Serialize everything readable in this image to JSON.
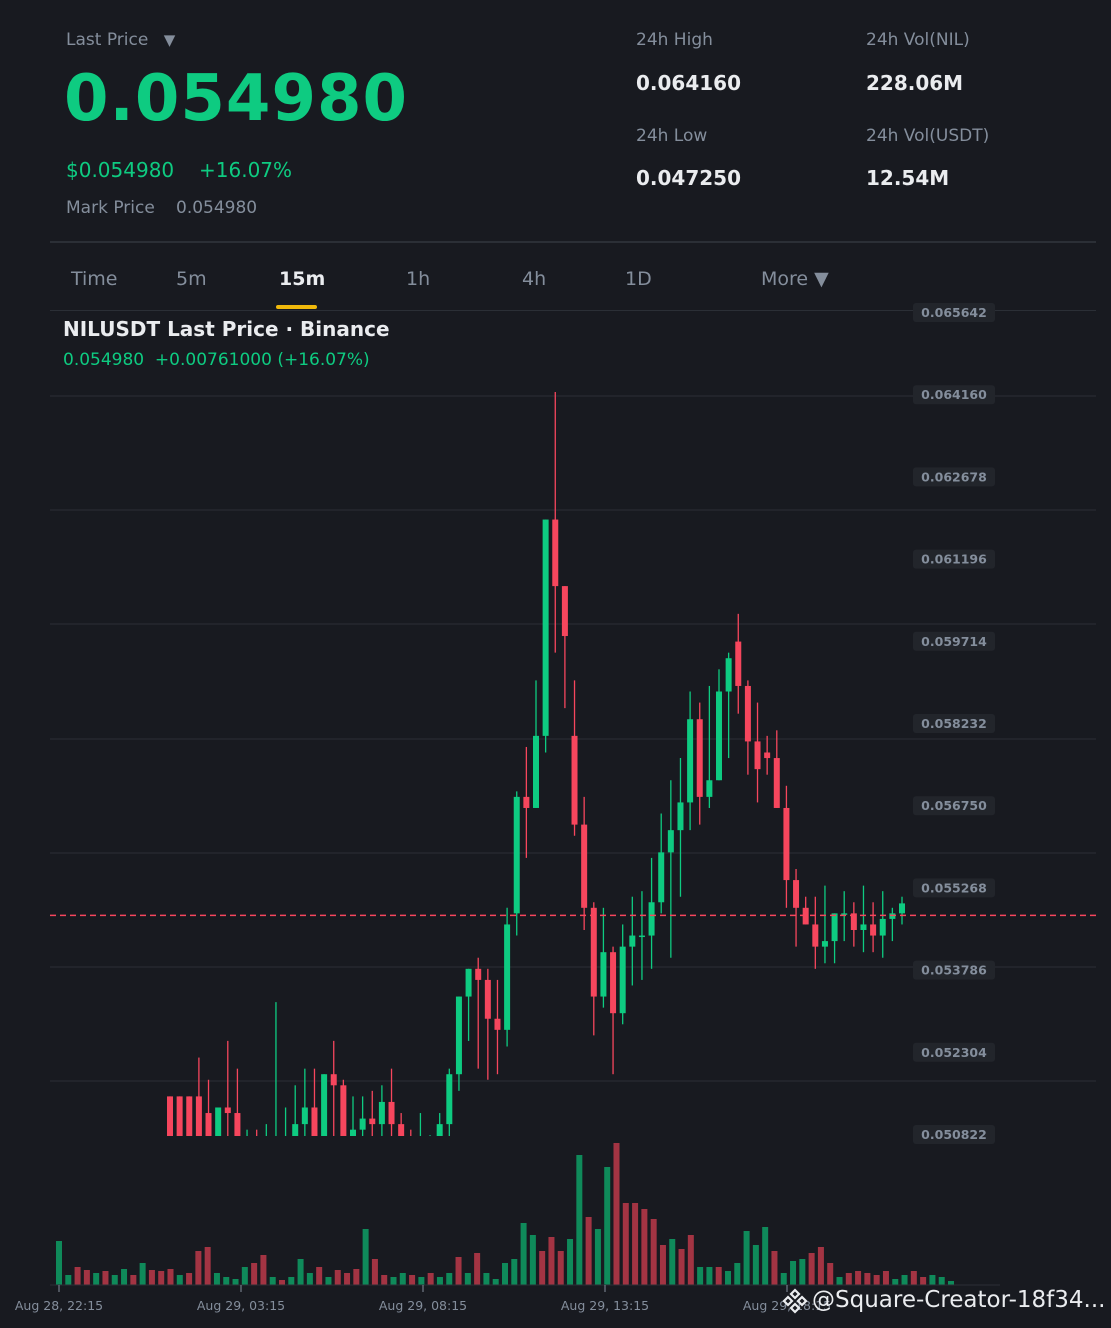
{
  "header": {
    "last_price_label": "Last Price",
    "last_price": "0.054980",
    "usd_price": "$0.054980",
    "change_pct": "+16.07%",
    "mark_price_label": "Mark Price",
    "mark_price": "0.054980",
    "stats": {
      "high_label": "24h High",
      "high_value": "0.064160",
      "low_label": "24h Low",
      "low_value": "0.047250",
      "vol_nil_label": "24h Vol(NIL)",
      "vol_nil_value": "228.06M",
      "vol_usdt_label": "24h Vol(USDT)",
      "vol_usdt_value": "12.54M"
    }
  },
  "tabs": [
    {
      "label": "Time"
    },
    {
      "label": "5m"
    },
    {
      "label": "15m"
    },
    {
      "label": "1h"
    },
    {
      "label": "4h"
    },
    {
      "label": "1D"
    },
    {
      "label": "More ▼"
    }
  ],
  "active_tab": "15m",
  "chart": {
    "title": "NILUSDT Last Price · Binance",
    "subtitle": "0.054980  +0.00761000 (+16.07%)"
  },
  "colors": {
    "up": "#0ecb81",
    "down": "#f6465d",
    "accent": "#f0b90b",
    "background": "#181a20"
  },
  "watermark": "@Square-Creator-18f34...",
  "chart_data": {
    "type": "candlestick",
    "price_ticks": [
      "0.065642",
      "0.064160",
      "0.062678",
      "0.061196",
      "0.059714",
      "0.058232",
      "0.056750",
      "0.055268",
      "0.053786",
      "0.052304",
      "0.050822"
    ],
    "time_labels": [
      "Aug 28, 22:15",
      "Aug 29, 03:15",
      "Aug 29, 08:15",
      "Aug 29, 13:15",
      "Aug 29, 18:15"
    ],
    "ylim": [
      0.050822,
      0.065642
    ],
    "last_price": 0.05498,
    "candles": [
      {
        "o": 0.0515,
        "h": 0.0512,
        "l": 0.05,
        "c": 0.05
      },
      {
        "o": 0.0515,
        "h": 0.0512,
        "l": 0.05,
        "c": 0.05
      },
      {
        "o": 0.0515,
        "h": 0.0512,
        "l": 0.05,
        "c": 0.05
      },
      {
        "o": 0.0515,
        "h": 0.0522,
        "l": 0.05,
        "c": 0.05
      },
      {
        "o": 0.0512,
        "h": 0.0518,
        "l": 0.05,
        "c": 0.05
      },
      {
        "o": 0.05,
        "h": 0.0513,
        "l": 0.05,
        "c": 0.0513
      },
      {
        "o": 0.0513,
        "h": 0.0525,
        "l": 0.05,
        "c": 0.0512
      },
      {
        "o": 0.0512,
        "h": 0.052,
        "l": 0.05,
        "c": 0.0501
      },
      {
        "o": 0.05,
        "h": 0.0509,
        "l": 0.05,
        "c": 0.0507
      },
      {
        "o": 0.0507,
        "h": 0.0509,
        "l": 0.05,
        "c": 0.05
      },
      {
        "o": 0.05,
        "h": 0.051,
        "l": 0.05,
        "c": 0.0501
      },
      {
        "o": 0.0501,
        "h": 0.0532,
        "l": 0.05,
        "c": 0.0503
      },
      {
        "o": 0.05,
        "h": 0.0513,
        "l": 0.05,
        "c": 0.0502
      },
      {
        "o": 0.0502,
        "h": 0.0517,
        "l": 0.05,
        "c": 0.051
      },
      {
        "o": 0.051,
        "h": 0.052,
        "l": 0.05,
        "c": 0.0513
      },
      {
        "o": 0.0513,
        "h": 0.052,
        "l": 0.05,
        "c": 0.05
      },
      {
        "o": 0.0502,
        "h": 0.0517,
        "l": 0.05,
        "c": 0.0519
      },
      {
        "o": 0.0519,
        "h": 0.0525,
        "l": 0.05,
        "c": 0.0517
      },
      {
        "o": 0.0517,
        "h": 0.0518,
        "l": 0.0505,
        "c": 0.0507
      },
      {
        "o": 0.0507,
        "h": 0.0515,
        "l": 0.05,
        "c": 0.0509
      },
      {
        "o": 0.0509,
        "h": 0.0515,
        "l": 0.0505,
        "c": 0.0511
      },
      {
        "o": 0.0511,
        "h": 0.0516,
        "l": 0.0505,
        "c": 0.051
      },
      {
        "o": 0.051,
        "h": 0.0517,
        "l": 0.0505,
        "c": 0.0514
      },
      {
        "o": 0.0514,
        "h": 0.052,
        "l": 0.0505,
        "c": 0.051
      },
      {
        "o": 0.051,
        "h": 0.0512,
        "l": 0.05,
        "c": 0.0506
      },
      {
        "o": 0.0506,
        "h": 0.0509,
        "l": 0.05,
        "c": 0.0502
      },
      {
        "o": 0.05,
        "h": 0.0512,
        "l": 0.05,
        "c": 0.05
      },
      {
        "o": 0.05,
        "h": 0.0508,
        "l": 0.05,
        "c": 0.0503
      },
      {
        "o": 0.0506,
        "h": 0.0512,
        "l": 0.0502,
        "c": 0.051
      },
      {
        "o": 0.051,
        "h": 0.052,
        "l": 0.0507,
        "c": 0.0519
      },
      {
        "o": 0.0519,
        "h": 0.0526,
        "l": 0.0516,
        "c": 0.0533
      },
      {
        "o": 0.0533,
        "h": 0.0538,
        "l": 0.0525,
        "c": 0.0538
      },
      {
        "o": 0.0538,
        "h": 0.054,
        "l": 0.052,
        "c": 0.0536
      },
      {
        "o": 0.0536,
        "h": 0.0538,
        "l": 0.0518,
        "c": 0.0529
      },
      {
        "o": 0.0529,
        "h": 0.0536,
        "l": 0.0519,
        "c": 0.0527
      },
      {
        "o": 0.0527,
        "h": 0.0549,
        "l": 0.0524,
        "c": 0.0546
      },
      {
        "o": 0.0548,
        "h": 0.057,
        "l": 0.0544,
        "c": 0.0569
      },
      {
        "o": 0.0569,
        "h": 0.0578,
        "l": 0.0558,
        "c": 0.0567
      },
      {
        "o": 0.0567,
        "h": 0.059,
        "l": 0.0567,
        "c": 0.058
      },
      {
        "o": 0.058,
        "h": 0.0619,
        "l": 0.0577,
        "c": 0.0619
      },
      {
        "o": 0.0619,
        "h": 0.0642,
        "l": 0.0595,
        "c": 0.0607
      },
      {
        "o": 0.0607,
        "h": 0.0605,
        "l": 0.0585,
        "c": 0.0598
      },
      {
        "o": 0.058,
        "h": 0.059,
        "l": 0.0562,
        "c": 0.0564
      },
      {
        "o": 0.0564,
        "h": 0.0569,
        "l": 0.0545,
        "c": 0.0549
      },
      {
        "o": 0.0549,
        "h": 0.055,
        "l": 0.0526,
        "c": 0.0533
      },
      {
        "o": 0.0533,
        "h": 0.0549,
        "l": 0.0531,
        "c": 0.0541
      },
      {
        "o": 0.0541,
        "h": 0.0542,
        "l": 0.0519,
        "c": 0.053
      },
      {
        "o": 0.053,
        "h": 0.0546,
        "l": 0.0528,
        "c": 0.0542
      },
      {
        "o": 0.0542,
        "h": 0.0551,
        "l": 0.0535,
        "c": 0.0544
      },
      {
        "o": 0.0544,
        "h": 0.0552,
        "l": 0.0536,
        "c": 0.0544
      },
      {
        "o": 0.0544,
        "h": 0.0558,
        "l": 0.0538,
        "c": 0.055
      },
      {
        "o": 0.055,
        "h": 0.0566,
        "l": 0.0548,
        "c": 0.0559
      },
      {
        "o": 0.0559,
        "h": 0.0572,
        "l": 0.054,
        "c": 0.0563
      },
      {
        "o": 0.0563,
        "h": 0.0576,
        "l": 0.0551,
        "c": 0.0568
      },
      {
        "o": 0.0568,
        "h": 0.0588,
        "l": 0.0563,
        "c": 0.0583
      },
      {
        "o": 0.0583,
        "h": 0.0586,
        "l": 0.0564,
        "c": 0.0569
      },
      {
        "o": 0.0569,
        "h": 0.0589,
        "l": 0.0567,
        "c": 0.0572
      },
      {
        "o": 0.0572,
        "h": 0.0592,
        "l": 0.0572,
        "c": 0.0588
      },
      {
        "o": 0.0588,
        "h": 0.0595,
        "l": 0.0576,
        "c": 0.0594
      },
      {
        "o": 0.0597,
        "h": 0.0602,
        "l": 0.0584,
        "c": 0.0589
      },
      {
        "o": 0.0589,
        "h": 0.059,
        "l": 0.0573,
        "c": 0.0579
      },
      {
        "o": 0.0579,
        "h": 0.0586,
        "l": 0.0568,
        "c": 0.0574
      },
      {
        "o": 0.0577,
        "h": 0.058,
        "l": 0.0573,
        "c": 0.0576
      },
      {
        "o": 0.0576,
        "h": 0.0581,
        "l": 0.0568,
        "c": 0.0567
      },
      {
        "o": 0.0567,
        "h": 0.0571,
        "l": 0.0549,
        "c": 0.0554
      },
      {
        "o": 0.0554,
        "h": 0.0556,
        "l": 0.0542,
        "c": 0.0549
      },
      {
        "o": 0.0549,
        "h": 0.0551,
        "l": 0.0546,
        "c": 0.0546
      },
      {
        "o": 0.0546,
        "h": 0.0551,
        "l": 0.0538,
        "c": 0.0542
      },
      {
        "o": 0.0542,
        "h": 0.0553,
        "l": 0.0539,
        "c": 0.0543
      },
      {
        "o": 0.0543,
        "h": 0.0548,
        "l": 0.0539,
        "c": 0.0548
      },
      {
        "o": 0.0548,
        "h": 0.0552,
        "l": 0.0543,
        "c": 0.0548
      },
      {
        "o": 0.0548,
        "h": 0.055,
        "l": 0.0542,
        "c": 0.0545
      },
      {
        "o": 0.0545,
        "h": 0.0553,
        "l": 0.0541,
        "c": 0.0546
      },
      {
        "o": 0.0546,
        "h": 0.055,
        "l": 0.0541,
        "c": 0.0544
      },
      {
        "o": 0.0544,
        "h": 0.0552,
        "l": 0.054,
        "c": 0.0547
      },
      {
        "o": 0.0547,
        "h": 0.0549,
        "l": 0.0543,
        "c": 0.0548
      },
      {
        "o": 0.0548,
        "h": 0.0551,
        "l": 0.0546,
        "c": 0.05498
      }
    ],
    "volumes": [
      {
        "v": 44,
        "up": true
      },
      {
        "v": 10,
        "up": true
      },
      {
        "v": 18,
        "up": false
      },
      {
        "v": 15,
        "up": false
      },
      {
        "v": 12,
        "up": true
      },
      {
        "v": 14,
        "up": false
      },
      {
        "v": 10,
        "up": true
      },
      {
        "v": 16,
        "up": true
      },
      {
        "v": 10,
        "up": false
      },
      {
        "v": 22,
        "up": true
      },
      {
        "v": 15,
        "up": false
      },
      {
        "v": 14,
        "up": false
      },
      {
        "v": 16,
        "up": false
      },
      {
        "v": 10,
        "up": true
      },
      {
        "v": 12,
        "up": false
      },
      {
        "v": 34,
        "up": false
      },
      {
        "v": 38,
        "up": false
      },
      {
        "v": 12,
        "up": true
      },
      {
        "v": 8,
        "up": true
      },
      {
        "v": 6,
        "up": true
      },
      {
        "v": 18,
        "up": true
      },
      {
        "v": 22,
        "up": false
      },
      {
        "v": 30,
        "up": false
      },
      {
        "v": 8,
        "up": true
      },
      {
        "v": 5,
        "up": false
      },
      {
        "v": 8,
        "up": true
      },
      {
        "v": 26,
        "up": true
      },
      {
        "v": 12,
        "up": true
      },
      {
        "v": 18,
        "up": false
      },
      {
        "v": 8,
        "up": true
      },
      {
        "v": 15,
        "up": false
      },
      {
        "v": 12,
        "up": false
      },
      {
        "v": 16,
        "up": false
      },
      {
        "v": 56,
        "up": true
      },
      {
        "v": 26,
        "up": false
      },
      {
        "v": 10,
        "up": false
      },
      {
        "v": 8,
        "up": true
      },
      {
        "v": 12,
        "up": true
      },
      {
        "v": 10,
        "up": false
      },
      {
        "v": 8,
        "up": true
      },
      {
        "v": 12,
        "up": false
      },
      {
        "v": 8,
        "up": true
      },
      {
        "v": 12,
        "up": true
      },
      {
        "v": 28,
        "up": false
      },
      {
        "v": 12,
        "up": true
      },
      {
        "v": 32,
        "up": false
      },
      {
        "v": 12,
        "up": true
      },
      {
        "v": 6,
        "up": true
      },
      {
        "v": 22,
        "up": true
      },
      {
        "v": 26,
        "up": true
      },
      {
        "v": 62,
        "up": true
      },
      {
        "v": 50,
        "up": true
      },
      {
        "v": 34,
        "up": false
      },
      {
        "v": 48,
        "up": false
      },
      {
        "v": 34,
        "up": false
      },
      {
        "v": 46,
        "up": true
      },
      {
        "v": 130,
        "up": true
      },
      {
        "v": 68,
        "up": false
      },
      {
        "v": 56,
        "up": true
      },
      {
        "v": 118,
        "up": true
      },
      {
        "v": 142,
        "up": false
      },
      {
        "v": 82,
        "up": false
      },
      {
        "v": 82,
        "up": false
      },
      {
        "v": 76,
        "up": false
      },
      {
        "v": 66,
        "up": false
      },
      {
        "v": 40,
        "up": false
      },
      {
        "v": 46,
        "up": true
      },
      {
        "v": 36,
        "up": false
      },
      {
        "v": 50,
        "up": false
      },
      {
        "v": 18,
        "up": true
      },
      {
        "v": 18,
        "up": true
      },
      {
        "v": 18,
        "up": false
      },
      {
        "v": 14,
        "up": true
      },
      {
        "v": 22,
        "up": true
      },
      {
        "v": 54,
        "up": true
      },
      {
        "v": 40,
        "up": true
      },
      {
        "v": 58,
        "up": true
      },
      {
        "v": 34,
        "up": false
      },
      {
        "v": 12,
        "up": true
      },
      {
        "v": 24,
        "up": true
      },
      {
        "v": 26,
        "up": true
      },
      {
        "v": 32,
        "up": false
      },
      {
        "v": 38,
        "up": false
      },
      {
        "v": 22,
        "up": false
      },
      {
        "v": 8,
        "up": true
      },
      {
        "v": 12,
        "up": false
      },
      {
        "v": 14,
        "up": false
      },
      {
        "v": 12,
        "up": false
      },
      {
        "v": 10,
        "up": false
      },
      {
        "v": 14,
        "up": false
      },
      {
        "v": 6,
        "up": true
      },
      {
        "v": 10,
        "up": true
      },
      {
        "v": 14,
        "up": false
      },
      {
        "v": 8,
        "up": false
      },
      {
        "v": 10,
        "up": true
      },
      {
        "v": 8,
        "up": true
      },
      {
        "v": 4,
        "up": true
      }
    ]
  }
}
